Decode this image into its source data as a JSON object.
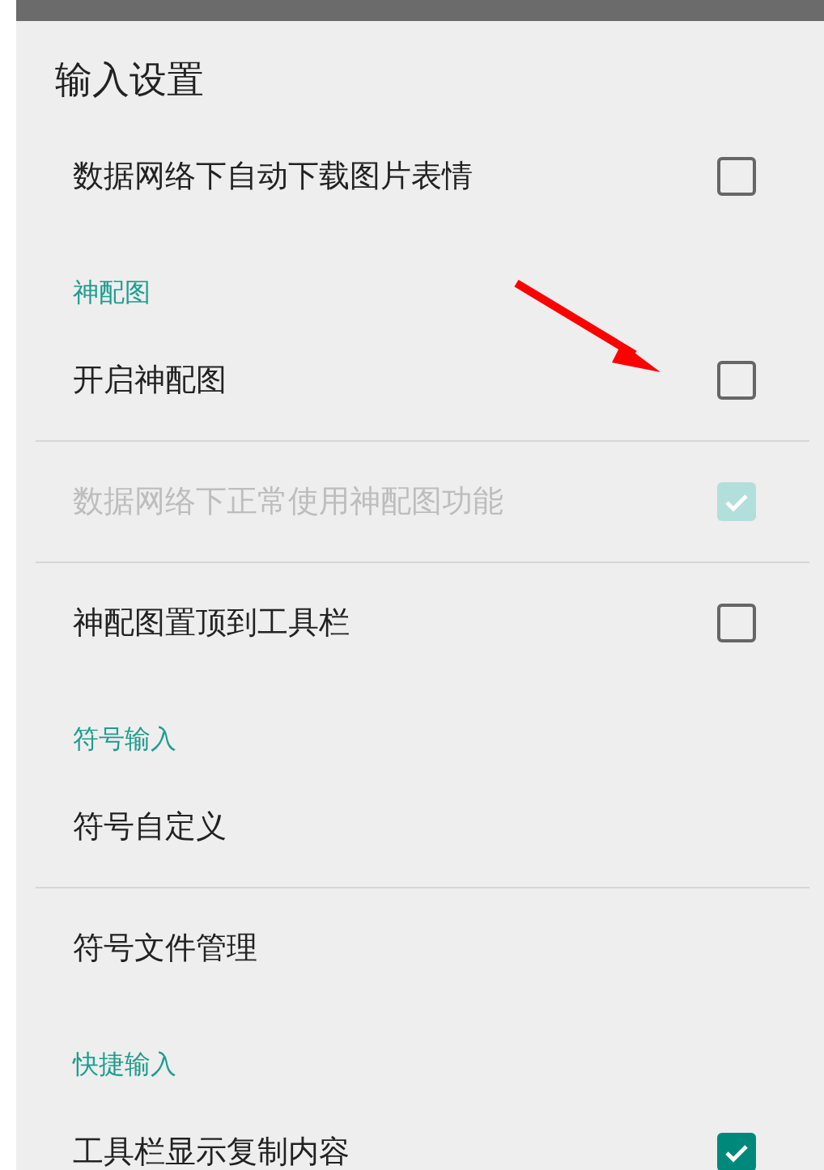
{
  "title": "输入设置",
  "sections": [
    {
      "items": [
        {
          "label": "数据网络下自动下载图片表情",
          "kind": "checkbox",
          "checked": false,
          "disabled": false
        }
      ]
    },
    {
      "header": "神配图",
      "items": [
        {
          "label": "开启神配图",
          "kind": "checkbox",
          "checked": false,
          "disabled": false
        },
        {
          "label": "数据网络下正常使用神配图功能",
          "kind": "checkbox",
          "checked": true,
          "disabled": true
        },
        {
          "label": "神配图置顶到工具栏",
          "kind": "checkbox",
          "checked": false,
          "disabled": false
        }
      ]
    },
    {
      "header": "符号输入",
      "items": [
        {
          "label": "符号自定义",
          "kind": "plain"
        },
        {
          "label": "符号文件管理",
          "kind": "plain"
        }
      ]
    },
    {
      "header": "快捷输入",
      "items": [
        {
          "label": "工具栏显示复制内容",
          "kind": "checkbox",
          "checked": true,
          "disabled": false
        }
      ]
    }
  ]
}
